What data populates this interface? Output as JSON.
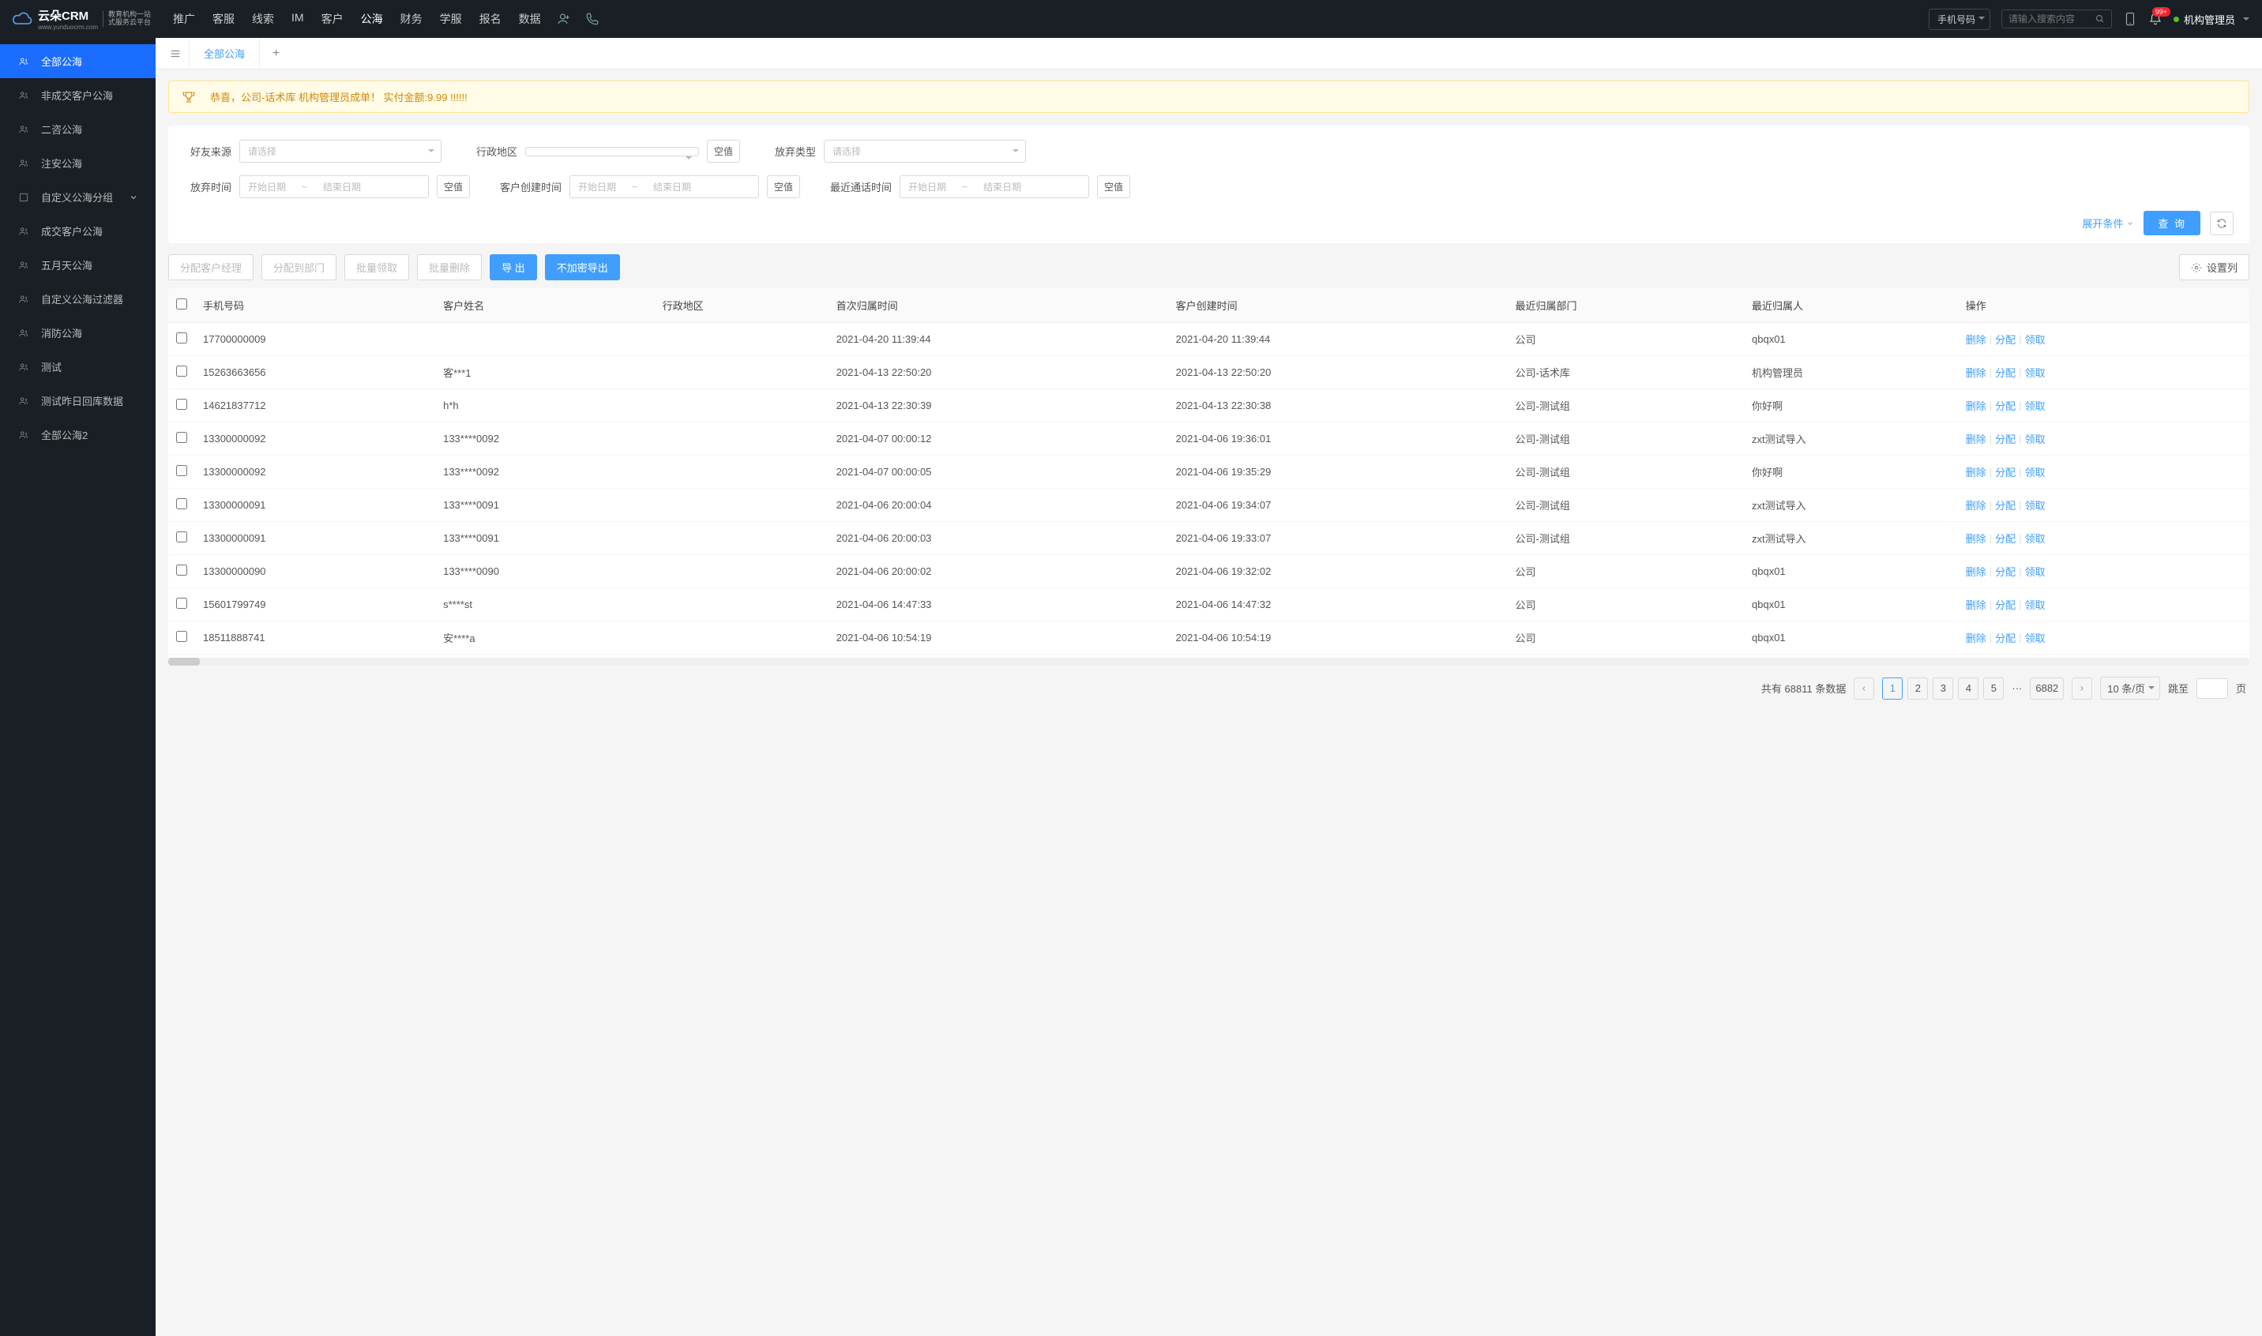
{
  "brand": {
    "name": "云朵CRM",
    "site": "www.yunduocrm.com",
    "sub1": "教育机构一站",
    "sub2": "式服务云平台"
  },
  "topnav": {
    "items": [
      "推广",
      "客服",
      "线索",
      "IM",
      "客户",
      "公海",
      "财务",
      "学服",
      "报名",
      "数据"
    ],
    "active": 5,
    "search_type": "手机号码",
    "search_placeholder": "请输入搜索内容",
    "badge": "99+",
    "user": "机构管理员"
  },
  "sidebar": {
    "items": [
      {
        "label": "全部公海",
        "active": true
      },
      {
        "label": "非成交客户公海"
      },
      {
        "label": "二咨公海"
      },
      {
        "label": "注安公海"
      },
      {
        "label": "自定义公海分组",
        "expand": true
      },
      {
        "label": "成交客户公海"
      },
      {
        "label": "五月天公海"
      },
      {
        "label": "自定义公海过滤器"
      },
      {
        "label": "消防公海"
      },
      {
        "label": "测试"
      },
      {
        "label": "测试昨日回库数据"
      },
      {
        "label": "全部公海2"
      }
    ]
  },
  "tabs": {
    "active": "全部公海"
  },
  "alert": "恭喜，公司-话术库  机构管理员成单！  实付金额:9.99 !!!!!!",
  "filters": {
    "friend_source": {
      "label": "好友来源",
      "placeholder": "请选择"
    },
    "admin_region": {
      "label": "行政地区",
      "empty": "空值"
    },
    "abandon_type": {
      "label": "放弃类型",
      "placeholder": "请选择"
    },
    "abandon_time": {
      "label": "放弃时间",
      "start": "开始日期",
      "end": "结束日期",
      "empty": "空值"
    },
    "create_time": {
      "label": "客户创建时间",
      "start": "开始日期",
      "end": "结束日期",
      "empty": "空值"
    },
    "last_call_time": {
      "label": "最近通话时间",
      "start": "开始日期",
      "end": "结束日期",
      "empty": "空值"
    },
    "expand": "展开条件",
    "search": "查 询"
  },
  "toolbar": {
    "assign_mgr": "分配客户经理",
    "assign_dept": "分配到部门",
    "batch_claim": "批量领取",
    "batch_delete": "批量删除",
    "export": "导 出",
    "export_plain": "不加密导出",
    "settings": "设置列"
  },
  "table": {
    "cols": [
      "手机号码",
      "客户姓名",
      "行政地区",
      "首次归属时间",
      "客户创建时间",
      "最近归属部门",
      "最近归属人",
      "操作"
    ],
    "ops": {
      "delete": "删除",
      "assign": "分配",
      "claim": "领取"
    },
    "rows": [
      {
        "phone": "17700000009",
        "name": "",
        "region": "",
        "first": "2021-04-20 11:39:44",
        "created": "2021-04-20 11:39:44",
        "dept": "公司",
        "owner": "qbqx01"
      },
      {
        "phone": "15263663656",
        "name": "客***1",
        "region": "",
        "first": "2021-04-13 22:50:20",
        "created": "2021-04-13 22:50:20",
        "dept": "公司-话术库",
        "owner": "机构管理员"
      },
      {
        "phone": "14621837712",
        "name": "h*h",
        "region": "",
        "first": "2021-04-13 22:30:39",
        "created": "2021-04-13 22:30:38",
        "dept": "公司-测试组",
        "owner": "你好啊"
      },
      {
        "phone": "13300000092",
        "name": "133****0092",
        "region": "",
        "first": "2021-04-07 00:00:12",
        "created": "2021-04-06 19:36:01",
        "dept": "公司-测试组",
        "owner": "zxt测试导入"
      },
      {
        "phone": "13300000092",
        "name": "133****0092",
        "region": "",
        "first": "2021-04-07 00:00:05",
        "created": "2021-04-06 19:35:29",
        "dept": "公司-测试组",
        "owner": "你好啊"
      },
      {
        "phone": "13300000091",
        "name": "133****0091",
        "region": "",
        "first": "2021-04-06 20:00:04",
        "created": "2021-04-06 19:34:07",
        "dept": "公司-测试组",
        "owner": "zxt测试导入"
      },
      {
        "phone": "13300000091",
        "name": "133****0091",
        "region": "",
        "first": "2021-04-06 20:00:03",
        "created": "2021-04-06 19:33:07",
        "dept": "公司-测试组",
        "owner": "zxt测试导入"
      },
      {
        "phone": "13300000090",
        "name": "133****0090",
        "region": "",
        "first": "2021-04-06 20:00:02",
        "created": "2021-04-06 19:32:02",
        "dept": "公司",
        "owner": "qbqx01"
      },
      {
        "phone": "15601799749",
        "name": "s****st",
        "region": "",
        "first": "2021-04-06 14:47:33",
        "created": "2021-04-06 14:47:32",
        "dept": "公司",
        "owner": "qbqx01"
      },
      {
        "phone": "18511888741",
        "name": "安****a",
        "region": "",
        "first": "2021-04-06 10:54:19",
        "created": "2021-04-06 10:54:19",
        "dept": "公司",
        "owner": "qbqx01"
      }
    ]
  },
  "pagination": {
    "total_prefix": "共有",
    "total": "68811",
    "total_suffix": "条数据",
    "pages": [
      "1",
      "2",
      "3",
      "4",
      "5"
    ],
    "last": "6882",
    "page_size": "10 条/页",
    "jump_label": "跳至",
    "page_suffix": "页"
  }
}
